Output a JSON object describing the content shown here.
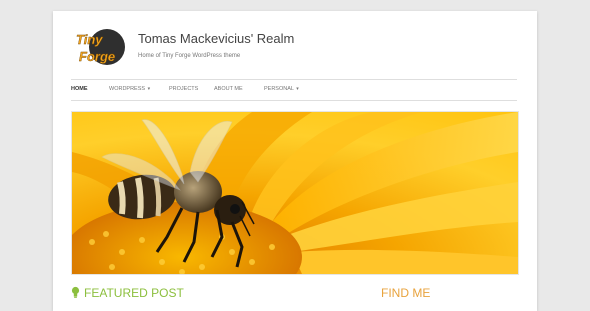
{
  "site": {
    "logo_text_line1": "Tiny",
    "logo_text_line2": "Forge",
    "title": "Tomas Mackevicius' Realm",
    "description": "Home of Tiny Forge WordPress theme"
  },
  "nav": {
    "items": [
      {
        "label": "Home",
        "active": true,
        "has_dropdown": false
      },
      {
        "label": "WordPress",
        "active": false,
        "has_dropdown": true
      },
      {
        "label": "Projects",
        "active": false,
        "has_dropdown": false
      },
      {
        "label": "About Me",
        "active": false,
        "has_dropdown": false
      },
      {
        "label": "Personal",
        "active": false,
        "has_dropdown": true
      }
    ]
  },
  "hero": {
    "subject": "bee-on-yellow-flower-photo"
  },
  "widgets": {
    "featured_title": "Featured Post",
    "findme_title": "Find Me"
  },
  "colors": {
    "featured_accent": "#8cbf3e",
    "findme_accent": "#e8a33d",
    "logo_text": "#f3a620",
    "logo_circle": "#2f2f2f"
  },
  "icons": {
    "featured_icon": "lightbulb-icon",
    "dropdown_icon": "chevron-down-icon"
  }
}
